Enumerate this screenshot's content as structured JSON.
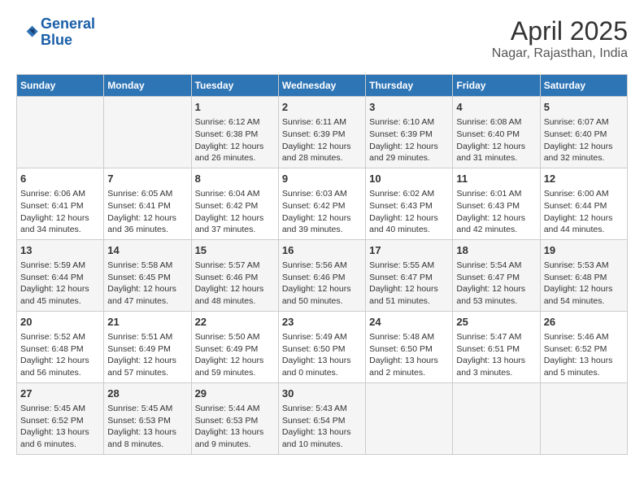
{
  "logo": {
    "line1": "General",
    "line2": "Blue"
  },
  "title": "April 2025",
  "subtitle": "Nagar, Rajasthan, India",
  "days_of_week": [
    "Sunday",
    "Monday",
    "Tuesday",
    "Wednesday",
    "Thursday",
    "Friday",
    "Saturday"
  ],
  "weeks": [
    [
      {
        "num": "",
        "info": ""
      },
      {
        "num": "",
        "info": ""
      },
      {
        "num": "1",
        "info": "Sunrise: 6:12 AM\nSunset: 6:38 PM\nDaylight: 12 hours and 26 minutes."
      },
      {
        "num": "2",
        "info": "Sunrise: 6:11 AM\nSunset: 6:39 PM\nDaylight: 12 hours and 28 minutes."
      },
      {
        "num": "3",
        "info": "Sunrise: 6:10 AM\nSunset: 6:39 PM\nDaylight: 12 hours and 29 minutes."
      },
      {
        "num": "4",
        "info": "Sunrise: 6:08 AM\nSunset: 6:40 PM\nDaylight: 12 hours and 31 minutes."
      },
      {
        "num": "5",
        "info": "Sunrise: 6:07 AM\nSunset: 6:40 PM\nDaylight: 12 hours and 32 minutes."
      }
    ],
    [
      {
        "num": "6",
        "info": "Sunrise: 6:06 AM\nSunset: 6:41 PM\nDaylight: 12 hours and 34 minutes."
      },
      {
        "num": "7",
        "info": "Sunrise: 6:05 AM\nSunset: 6:41 PM\nDaylight: 12 hours and 36 minutes."
      },
      {
        "num": "8",
        "info": "Sunrise: 6:04 AM\nSunset: 6:42 PM\nDaylight: 12 hours and 37 minutes."
      },
      {
        "num": "9",
        "info": "Sunrise: 6:03 AM\nSunset: 6:42 PM\nDaylight: 12 hours and 39 minutes."
      },
      {
        "num": "10",
        "info": "Sunrise: 6:02 AM\nSunset: 6:43 PM\nDaylight: 12 hours and 40 minutes."
      },
      {
        "num": "11",
        "info": "Sunrise: 6:01 AM\nSunset: 6:43 PM\nDaylight: 12 hours and 42 minutes."
      },
      {
        "num": "12",
        "info": "Sunrise: 6:00 AM\nSunset: 6:44 PM\nDaylight: 12 hours and 44 minutes."
      }
    ],
    [
      {
        "num": "13",
        "info": "Sunrise: 5:59 AM\nSunset: 6:44 PM\nDaylight: 12 hours and 45 minutes."
      },
      {
        "num": "14",
        "info": "Sunrise: 5:58 AM\nSunset: 6:45 PM\nDaylight: 12 hours and 47 minutes."
      },
      {
        "num": "15",
        "info": "Sunrise: 5:57 AM\nSunset: 6:46 PM\nDaylight: 12 hours and 48 minutes."
      },
      {
        "num": "16",
        "info": "Sunrise: 5:56 AM\nSunset: 6:46 PM\nDaylight: 12 hours and 50 minutes."
      },
      {
        "num": "17",
        "info": "Sunrise: 5:55 AM\nSunset: 6:47 PM\nDaylight: 12 hours and 51 minutes."
      },
      {
        "num": "18",
        "info": "Sunrise: 5:54 AM\nSunset: 6:47 PM\nDaylight: 12 hours and 53 minutes."
      },
      {
        "num": "19",
        "info": "Sunrise: 5:53 AM\nSunset: 6:48 PM\nDaylight: 12 hours and 54 minutes."
      }
    ],
    [
      {
        "num": "20",
        "info": "Sunrise: 5:52 AM\nSunset: 6:48 PM\nDaylight: 12 hours and 56 minutes."
      },
      {
        "num": "21",
        "info": "Sunrise: 5:51 AM\nSunset: 6:49 PM\nDaylight: 12 hours and 57 minutes."
      },
      {
        "num": "22",
        "info": "Sunrise: 5:50 AM\nSunset: 6:49 PM\nDaylight: 12 hours and 59 minutes."
      },
      {
        "num": "23",
        "info": "Sunrise: 5:49 AM\nSunset: 6:50 PM\nDaylight: 13 hours and 0 minutes."
      },
      {
        "num": "24",
        "info": "Sunrise: 5:48 AM\nSunset: 6:50 PM\nDaylight: 13 hours and 2 minutes."
      },
      {
        "num": "25",
        "info": "Sunrise: 5:47 AM\nSunset: 6:51 PM\nDaylight: 13 hours and 3 minutes."
      },
      {
        "num": "26",
        "info": "Sunrise: 5:46 AM\nSunset: 6:52 PM\nDaylight: 13 hours and 5 minutes."
      }
    ],
    [
      {
        "num": "27",
        "info": "Sunrise: 5:45 AM\nSunset: 6:52 PM\nDaylight: 13 hours and 6 minutes."
      },
      {
        "num": "28",
        "info": "Sunrise: 5:45 AM\nSunset: 6:53 PM\nDaylight: 13 hours and 8 minutes."
      },
      {
        "num": "29",
        "info": "Sunrise: 5:44 AM\nSunset: 6:53 PM\nDaylight: 13 hours and 9 minutes."
      },
      {
        "num": "30",
        "info": "Sunrise: 5:43 AM\nSunset: 6:54 PM\nDaylight: 13 hours and 10 minutes."
      },
      {
        "num": "",
        "info": ""
      },
      {
        "num": "",
        "info": ""
      },
      {
        "num": "",
        "info": ""
      }
    ]
  ]
}
